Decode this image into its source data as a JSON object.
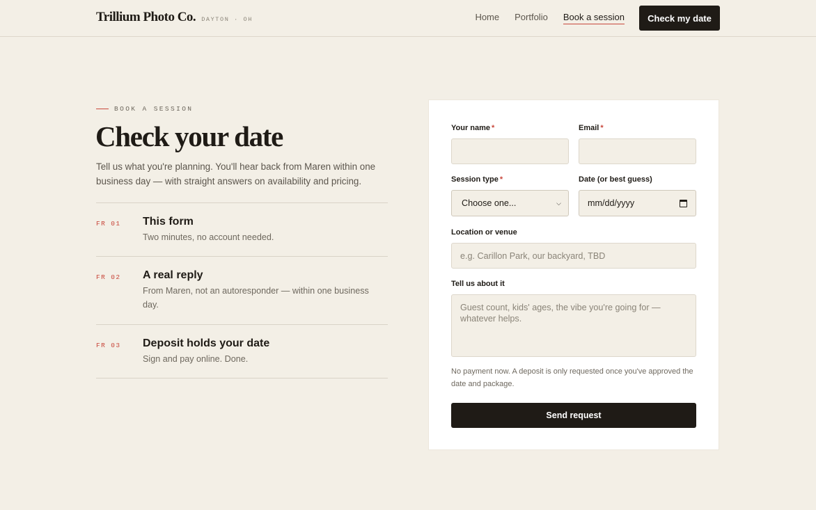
{
  "header": {
    "brand_name": "Trillium Photo Co.",
    "brand_location": "DAYTON · OH",
    "nav": [
      {
        "label": "Home",
        "active": false
      },
      {
        "label": "Portfolio",
        "active": false
      },
      {
        "label": "Book a session",
        "active": true
      }
    ],
    "cta_label": "Check my date"
  },
  "hero": {
    "eyebrow": "BOOK A SESSION",
    "title": "Check your date",
    "intro": "Tell us what you're planning. You'll hear back from Maren within one business day — with straight answers on availability and pricing."
  },
  "steps": [
    {
      "num": "FR 01",
      "title": "This form",
      "desc": "Two minutes, no account needed."
    },
    {
      "num": "FR 02",
      "title": "A real reply",
      "desc": "From Maren, not an autoresponder — within one business day."
    },
    {
      "num": "FR 03",
      "title": "Deposit holds your date",
      "desc": "Sign and pay online. Done."
    }
  ],
  "form": {
    "name_label": "Your name",
    "email_label": "Email",
    "required_mark": "*",
    "name_value": "",
    "email_value": "",
    "session_label": "Session type",
    "session_value": "Choose one...",
    "date_label": "Date (or best guess)",
    "date_value": "mm/dd/yyyy",
    "location_label": "Location or venue",
    "location_placeholder": "e.g. Carillon Park, our backyard, TBD",
    "about_label": "Tell us about it",
    "about_placeholder": "Guest count, kids' ages, the vibe you're going for — whatever helps.",
    "note": "No payment now. A deposit is only requested once you've approved the date and package.",
    "submit_label": "Send request"
  },
  "colors": {
    "background": "#f3efe6",
    "ink": "#1f1b16",
    "accent": "#c8473b",
    "card": "#ffffff"
  },
  "icons": {
    "session_select": "chevron-down-icon",
    "date_picker": "calendar-icon"
  }
}
